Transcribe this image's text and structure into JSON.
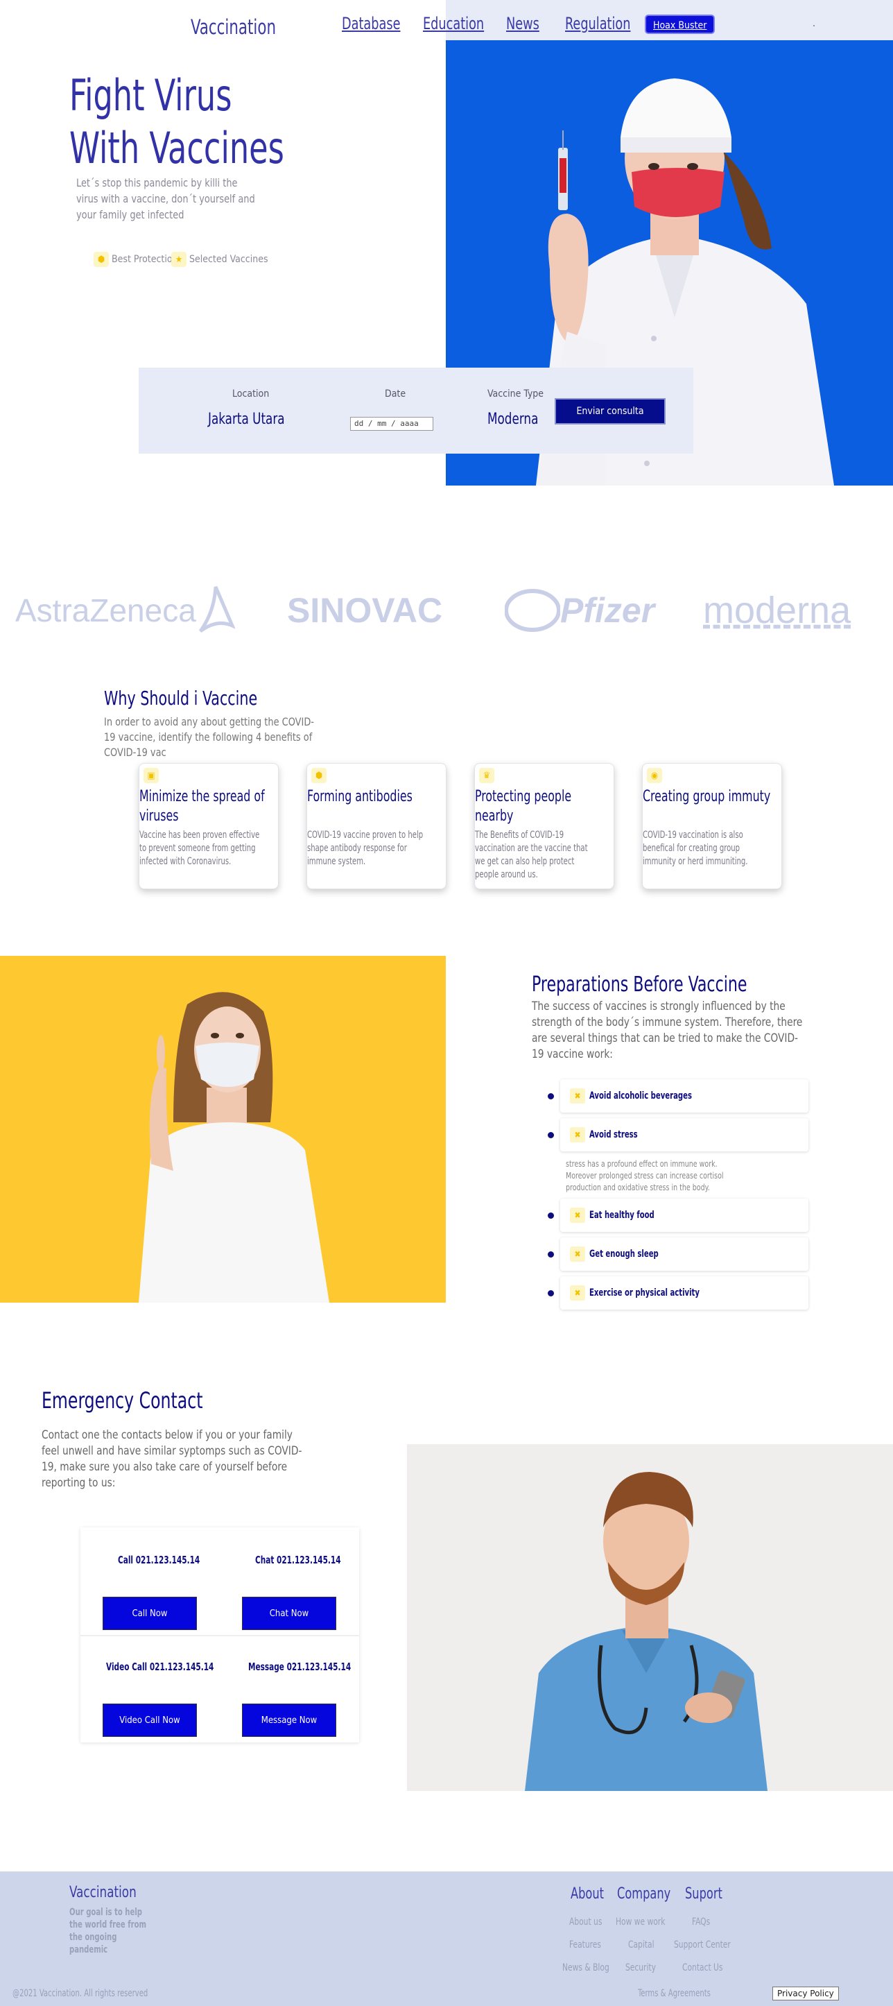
{
  "header": {
    "logo": "Vaccination",
    "nav": [
      "Database",
      "Education",
      "News",
      "Regulation"
    ],
    "hoax": "Hoax Buster",
    "dot": "."
  },
  "hero": {
    "title_line1": "Fight Virus",
    "title_line2": "With Vaccines",
    "text": "Let´s stop this pandemic by killi the virus with a vaccine, don´t yourself and your family get infected",
    "badges": [
      "Best Protection",
      "Selected Vaccines"
    ]
  },
  "search": {
    "location_label": "Location",
    "location_value": "Jakarta Utara",
    "date_label": "Date",
    "date_placeholder": "dd / mm / aaaa",
    "vaccine_label": "Vaccine Type",
    "vaccine_value": "Moderna",
    "button": "Enviar consulta"
  },
  "brands": [
    "AstraZeneca",
    "SINOVAC",
    "Pfizer",
    "moderna"
  ],
  "why": {
    "title": "Why Should i Vaccine",
    "text": "In order to avoid any about getting the COVID-19 vaccine, identify the following 4 benefits of COVID-19 vac",
    "cards": [
      {
        "title": "Minimize the spread of viruses",
        "text": "Vaccine has been proven effective to prevent someone from getting infected with Coronavirus."
      },
      {
        "title": "Forming antibodies",
        "text": "COVID-19 vaccine proven to help shape antibody response for immune system."
      },
      {
        "title": "Protecting people nearby",
        "text": "The Benefits of COVID-19 vaccination are the vaccine that we get can also help protect people around us."
      },
      {
        "title": "Creating group immuty",
        "text": "COVID-19 vaccination is also benefical for creating group immunity or herd immuniting."
      }
    ]
  },
  "prep": {
    "title": "Preparations Before Vaccine",
    "text": "The success of vaccines is strongly influenced by the strength of the body´s immune system. Therefore, there are several things that can be tried to make the COVID-19 vaccine work:",
    "items": [
      "Avoid alcoholic beverages",
      "Avoid stress",
      "Eat healthy food",
      "Get enough sleep",
      "Exercise or physical activity"
    ],
    "stress_text": "stress has a profound effect on immune work. Moreover prolonged stress can increase cortisol production and oxidative stress in the body."
  },
  "emergency": {
    "title": "Emergency Contact",
    "text": "Contact one the contacts below if you or your family feel unwell and have similar syptomps such as COVID-19, make sure you also take care of yourself before reporting to us:",
    "contacts": [
      {
        "label": "Call 021.123.145.14",
        "button": "Call Now"
      },
      {
        "label": "Chat 021.123.145.14",
        "button": "Chat Now"
      },
      {
        "label": "Video Call 021.123.145.14",
        "button": "Video Call Now"
      },
      {
        "label": "Message 021.123.145.14",
        "button": "Message Now"
      }
    ]
  },
  "footer": {
    "logo": "Vaccination",
    "tagline": "Our goal is to help the world free from the ongoing pandemic",
    "cols": [
      {
        "head": "About",
        "links": [
          "About us",
          "Features",
          "News & Blog"
        ]
      },
      {
        "head": "Company",
        "links": [
          "How we work",
          "Capital",
          "Security"
        ]
      },
      {
        "head": "Suport",
        "links": [
          "FAQs",
          "Support Center",
          "Contact Us"
        ]
      }
    ],
    "copyright": "@2021 Vaccination. All rights reserved",
    "terms": "Terms & Agreements",
    "privacy": "Privacy Policy"
  },
  "colors": {
    "navy": "#0d0d80",
    "accent": "#3a3aa6",
    "blue_bg": "#0b5ee0",
    "yellow_bg": "#fec930",
    "button_blue": "#0505de",
    "icon_yellow": "#f2c200"
  }
}
